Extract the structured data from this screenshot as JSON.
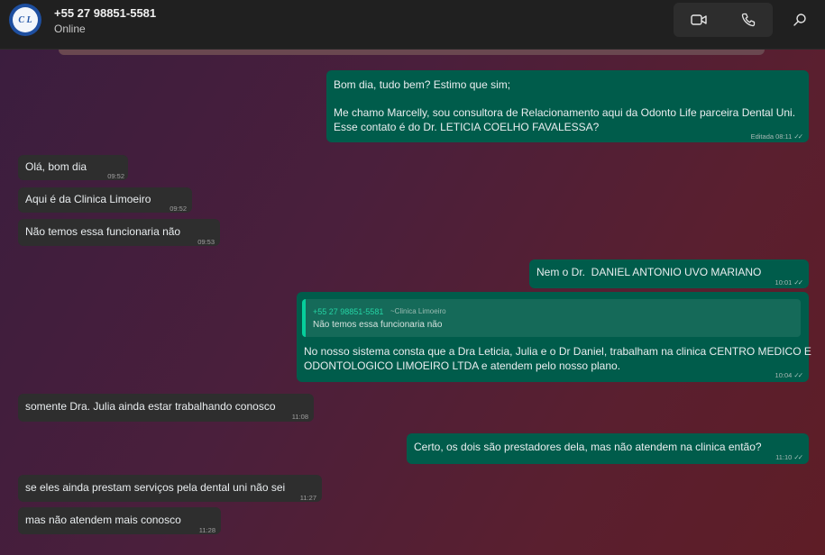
{
  "header": {
    "avatar_text": "C L",
    "contact_name": "+55 27 98851-5581",
    "status": "Online",
    "icons": [
      "video-call-icon",
      "voice-call-icon",
      "search-icon"
    ]
  },
  "messages": [
    {
      "id": "m1",
      "dir": "out",
      "lines": [
        "Bom dia, tudo bem? Estimo que sim;",
        "",
        "Me chamo Marcelly, sou consultora de Relacionamento aqui da Odonto Life parceira Dental Uni.",
        "Esse contato é do Dr. LETICIA COELHO FAVALESSA?"
      ],
      "time": "Editada 08:11",
      "ticks": "✓✓"
    },
    {
      "id": "m2",
      "dir": "in",
      "lines": [
        "Olá, bom dia"
      ],
      "time": "09:52"
    },
    {
      "id": "m3",
      "dir": "in",
      "lines": [
        "Aqui é da Clinica Limoeiro"
      ],
      "time": "09:52"
    },
    {
      "id": "m4",
      "dir": "in",
      "lines": [
        "Não temos essa funcionaria não"
      ],
      "time": "09:53"
    },
    {
      "id": "m5",
      "dir": "out",
      "lines": [
        "Nem o Dr.  DANIEL ANTONIO UVO MARIANO"
      ],
      "time": "10:01",
      "ticks": "✓✓"
    },
    {
      "id": "m6",
      "dir": "out",
      "quote": {
        "author": "+55 27 98851-5581",
        "extra": "~Clinica Limoeiro",
        "text": "Não temos essa funcionaria não"
      },
      "lines": [
        "No nosso sistema consta que a Dra Leticia, Julia e o Dr Daniel, trabalham na clinica CENTRO MEDICO E",
        "ODONTOLOGICO LIMOEIRO LTDA e atendem pelo nosso plano."
      ],
      "time": "10:04",
      "ticks": "✓✓"
    },
    {
      "id": "m7",
      "dir": "in",
      "lines": [
        "somente Dra. Julia ainda estar trabalhando conosco"
      ],
      "time": "11:08"
    },
    {
      "id": "m8",
      "dir": "out",
      "lines": [
        "Certo, os dois são prestadores dela, mas não atendem na clinica então?"
      ],
      "time": "11:10",
      "ticks": "✓✓"
    },
    {
      "id": "m9",
      "dir": "in",
      "lines": [
        "se eles ainda prestam serviços pela dental uni não sei"
      ],
      "time": "11:27"
    },
    {
      "id": "m10",
      "dir": "in",
      "lines": [
        "mas não atendem mais conosco"
      ],
      "time": "11:28"
    }
  ]
}
